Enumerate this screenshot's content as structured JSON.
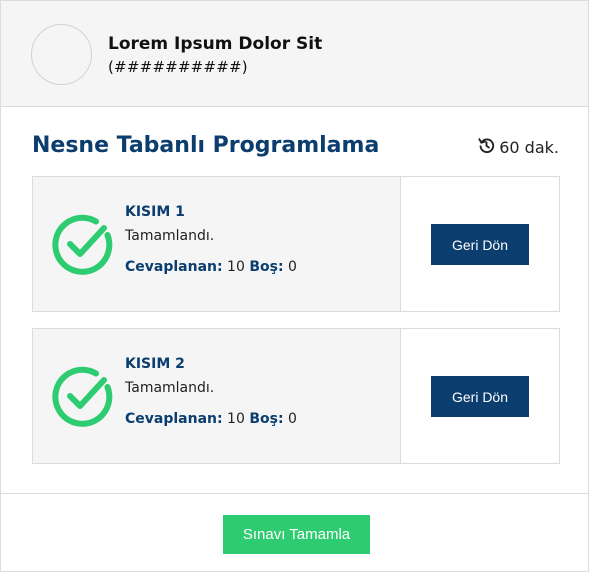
{
  "user": {
    "name": "Lorem Ipsum Dolor Sit",
    "id": "(##########)"
  },
  "exam": {
    "title": "Nesne Tabanlı Programlama",
    "duration": "60 dak."
  },
  "sections": [
    {
      "title": "KISIM 1",
      "status": "Tamamlandı.",
      "answered_label": "Cevaplanan:",
      "answered_value": "10",
      "empty_label": "Boş:",
      "empty_value": "0",
      "button_label": "Geri Dön"
    },
    {
      "title": "KISIM 2",
      "status": "Tamamlandı.",
      "answered_label": "Cevaplanan:",
      "answered_value": "10",
      "empty_label": "Boş:",
      "empty_value": "0",
      "button_label": "Geri Dön"
    }
  ],
  "footer": {
    "finish_label": "Sınavı Tamamla"
  },
  "colors": {
    "primary": "#0b3d6e",
    "success": "#2ecc71",
    "panel_bg": "#f5f5f5",
    "border": "#dcdcdc"
  },
  "icons": {
    "duration": "history-icon",
    "completed": "check-circle-icon"
  }
}
